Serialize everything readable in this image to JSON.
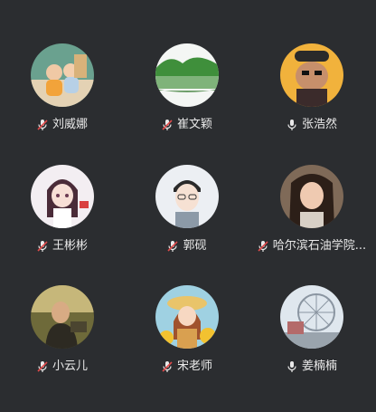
{
  "participants": [
    {
      "name": "刘威娜",
      "mic": "muted",
      "avatar": "photo-children-icon"
    },
    {
      "name": "崔文颖",
      "mic": "muted",
      "avatar": "photo-lake-icon"
    },
    {
      "name": "张浩然",
      "mic": "on",
      "avatar": "photo-dog-icon"
    },
    {
      "name": "王彬彬",
      "mic": "muted",
      "avatar": "cartoon-girl-icon"
    },
    {
      "name": "郭砚",
      "mic": "muted",
      "avatar": "cartoon-man-icon"
    },
    {
      "name": "哈尔滨石油学院...",
      "mic": "muted",
      "avatar": "photo-woman-icon"
    },
    {
      "name": "小云儿",
      "mic": "muted",
      "avatar": "photo-portrait-icon"
    },
    {
      "name": "宋老师",
      "mic": "muted",
      "avatar": "painting-sunflower-girl-icon"
    },
    {
      "name": "姜楠楠",
      "mic": "on",
      "avatar": "photo-ferris-wheel-icon"
    }
  ],
  "colors": {
    "background": "#2b2d30",
    "text": "#e9e9e9",
    "muted_slash": "#e14b4b"
  }
}
